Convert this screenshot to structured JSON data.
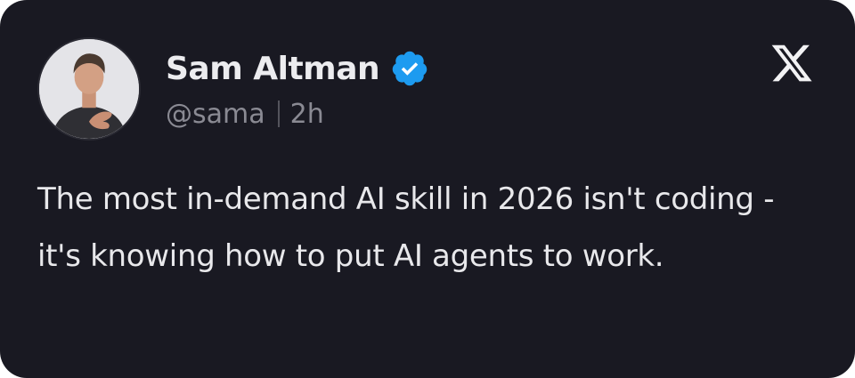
{
  "post": {
    "author_name": "Sam Altman",
    "handle": "@sama",
    "time_ago": "2h",
    "text": "The most in-demand AI skill in 2026 isn't coding - it's knowing how to put AI agents to work."
  },
  "icons": {
    "verified": "verified-badge-icon",
    "platform": "x-logo-icon",
    "avatar": "profile-photo"
  },
  "colors": {
    "card_background": "#191922",
    "name_text": "#ececef",
    "meta_text": "#8a8a93",
    "body_text": "#e8e8eb",
    "verified_blue": "#1d9bf0"
  }
}
